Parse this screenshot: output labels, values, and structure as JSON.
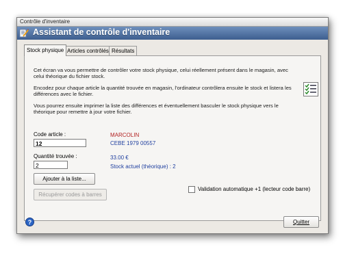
{
  "window": {
    "title": "Contrôle d'inventaire"
  },
  "header": {
    "title": "Assistant de contrôle d'inventaire",
    "icon": "inventory-wizard-icon"
  },
  "tabs": [
    {
      "label": "Stock physique",
      "active": true
    },
    {
      "label": "Articles contrôlés",
      "active": false
    },
    {
      "label": "Résultats",
      "active": false
    }
  ],
  "intro": {
    "p1": "Cet écran va vous permettre de contrôler votre stock physique, celui réellement présent dans le magasin, avec celui théorique du fichier stock.",
    "p2": "Encodez pour chaque article la quantité trouvée en magasin, l'ordinateur contrôlera ensuite le stock et listera les différences avec le fichier.",
    "p3": "Vous pourrez ensuite imprimer la liste des différences et éventuellement basculer le stock physique vers le théorique pour remettre à jour votre fichier."
  },
  "form": {
    "code_label": "Code article :",
    "code_value": "12",
    "qty_label": "Quantité trouvée :",
    "qty_value": "2"
  },
  "article": {
    "name": "MARCOLIN",
    "ref": "CEBE 1979 00557",
    "price": "33.00 €",
    "stock": "Stock actuel (théorique) : 2"
  },
  "buttons": {
    "add": "Ajouter à la liste...",
    "fetch": "Récupérer codes à barres",
    "quit": "Quitter"
  },
  "checkbox": {
    "label": "Validation automatique +1 (lecteur code barre)",
    "checked": false
  },
  "colors": {
    "header": "#4a6a9a",
    "article_name": "#b22222",
    "article_info": "#1f3f9f"
  }
}
